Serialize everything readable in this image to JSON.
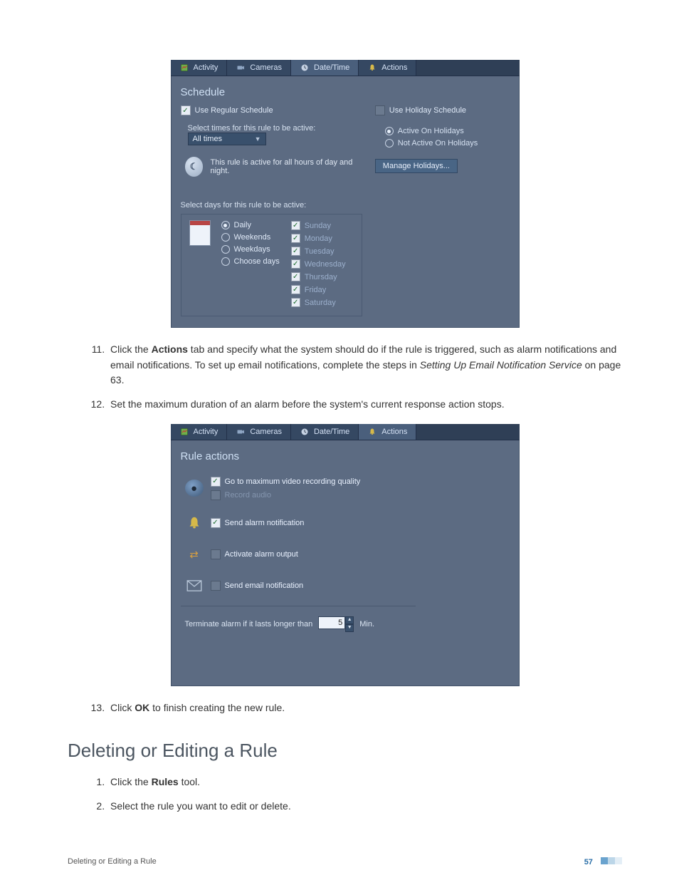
{
  "tabs": {
    "activity": "Activity",
    "cameras": "Cameras",
    "datetime": "Date/Time",
    "actions": "Actions"
  },
  "schedule": {
    "title": "Schedule",
    "use_regular": "Use Regular Schedule",
    "select_times_label": "Select times for this rule to be active:",
    "select_value": "All times",
    "clock_note": "This rule is active for all hours of day and night.",
    "select_days_label": "Select days for this rule to be active:",
    "radios": {
      "daily": "Daily",
      "weekends": "Weekends",
      "weekdays": "Weekdays",
      "choose": "Choose days"
    },
    "days": {
      "sun": "Sunday",
      "mon": "Monday",
      "tue": "Tuesday",
      "wed": "Wednesday",
      "thu": "Thursday",
      "fri": "Friday",
      "sat": "Saturday"
    },
    "holiday": {
      "use_holiday": "Use Holiday Schedule",
      "active": "Active On Holidays",
      "notactive": "Not Active On Holidays",
      "manage_btn": "Manage Holidays..."
    }
  },
  "ruleactions": {
    "title": "Rule actions",
    "go_max": "Go to maximum video recording quality",
    "record_audio": "Record audio",
    "send_alarm": "Send alarm notification",
    "activate_output": "Activate alarm output",
    "send_email": "Send email notification",
    "terminate_label": "Terminate alarm if it lasts longer than",
    "terminate_value": "5",
    "terminate_unit": "Min."
  },
  "steps": {
    "s11a": "Click the ",
    "s11b": "Actions",
    "s11c": " tab and specify what the system should do if the rule is triggered, such as alarm notifications and email notifications. To set up email notifications, complete the steps in ",
    "s11d": "Setting Up Email Notification Service",
    "s11e": " on page 63.",
    "s12": "Set the maximum duration of an alarm before the system's current response action stops.",
    "s13a": "Click ",
    "s13b": "OK",
    "s13c": " to finish creating the new rule."
  },
  "section2": {
    "heading": "Deleting or Editing a Rule",
    "i1a": "Click the ",
    "i1b": "Rules",
    "i1c": " tool.",
    "i2": "Select the rule you want to edit or delete."
  },
  "footer": {
    "left": "Deleting or Editing a Rule",
    "page": "57"
  }
}
